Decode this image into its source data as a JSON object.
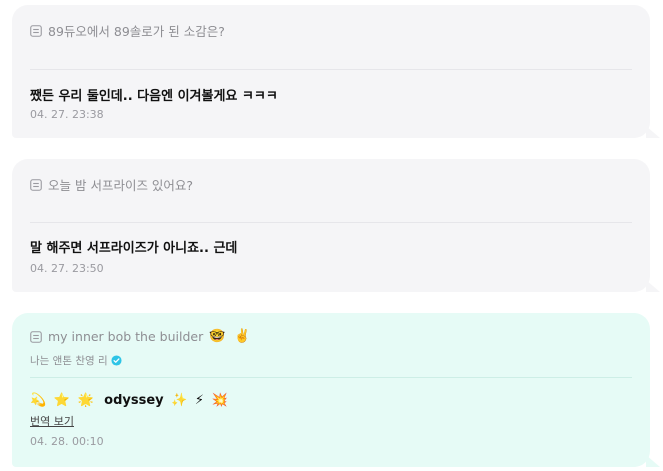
{
  "items": [
    {
      "question": "89듀오에서 89솔로가 된 소감은?",
      "answer": "쨌든 우리 둘인데.. 다음엔 이겨볼게요 ㅋㅋㅋ",
      "timestamp": "04. 27. 23:38"
    },
    {
      "question": "오늘 밤 서프라이즈 있어요?",
      "answer": "말 해주면 서프라이즈가 아니죠.. 근데",
      "timestamp": "04. 27. 23:50"
    },
    {
      "question": "my inner bob the builder",
      "question_emojis": [
        "🤓",
        "✌️"
      ],
      "author": "나는 앤톤 찬영 리",
      "answer_leading_emojis": [
        "💫",
        "⭐",
        "🌟"
      ],
      "answer": "odyssey",
      "answer_trailing_emojis": [
        "✨",
        "⚡",
        "💥"
      ],
      "translate_label": "번역 보기",
      "timestamp": "04. 28. 00:10"
    }
  ],
  "colors": {
    "card_gray": "#f5f5f7",
    "card_mint": "#e6fbf6",
    "verified_badge": "#2ec4e6"
  }
}
